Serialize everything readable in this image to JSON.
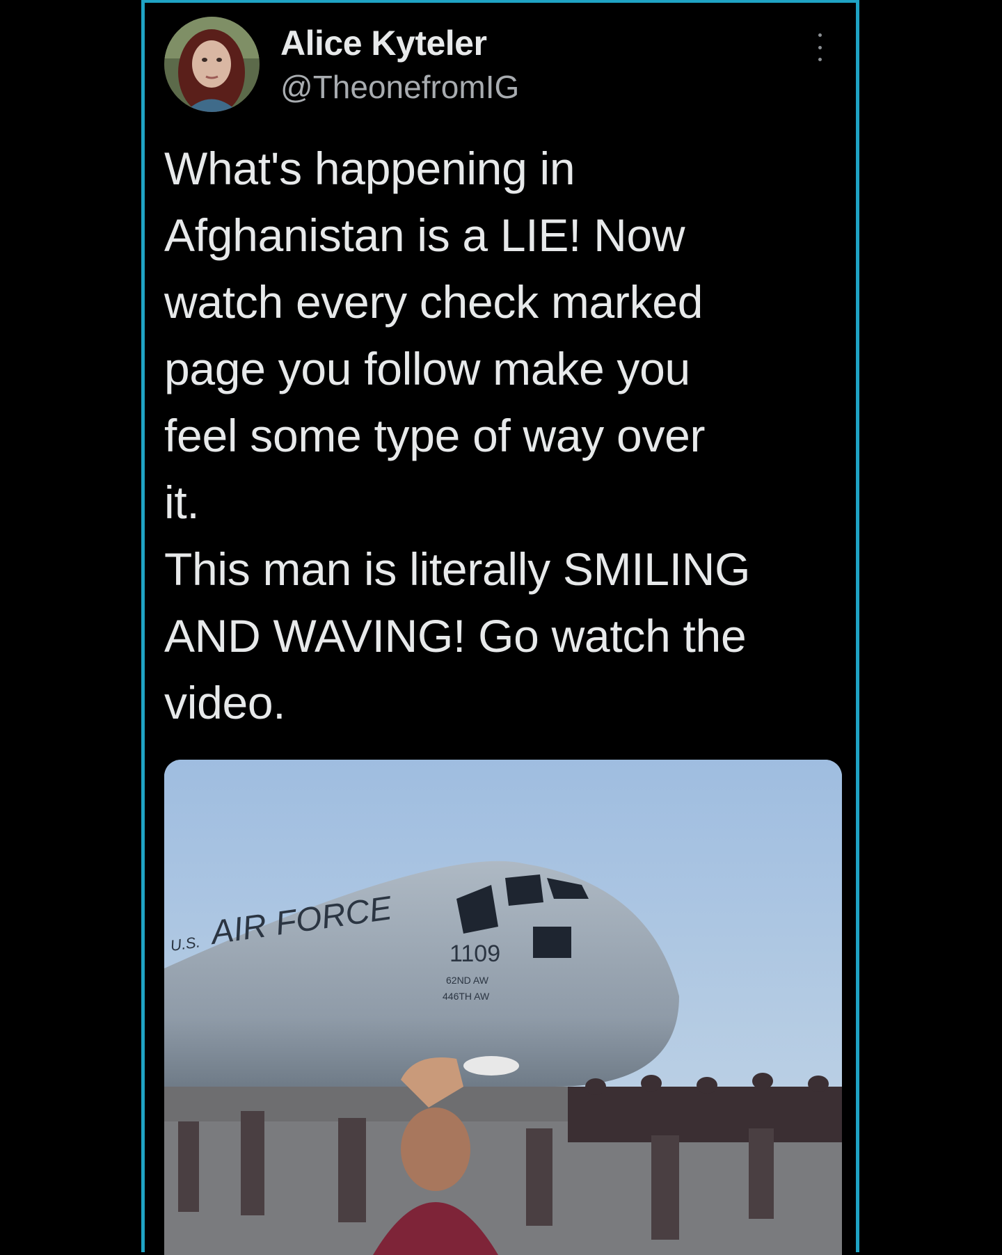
{
  "tweet": {
    "display_name": "Alice Kyteler",
    "handle": "@TheonefromIG",
    "text": "What's happening in\nAfghanistan is a LIE! Now\nwatch every check marked\npage you follow make you\nfeel some type of way over\nit.\nThis man is literally SMILING\nAND WAVING! Go watch the\nvideo.",
    "more_icon": "more-vertical-icon",
    "avatar_icon": "user-avatar"
  },
  "media": {
    "plane_marking": "AIR FORCE",
    "tail_prefix": "U.S.",
    "nose_number": "1109",
    "wing_code_1": "62ND AW",
    "wing_code_2": "446TH AW"
  },
  "colors": {
    "frame_border": "#1fa3c4",
    "background": "#000000",
    "text_primary": "#e7e9ea",
    "text_secondary": "#a8acb0"
  }
}
